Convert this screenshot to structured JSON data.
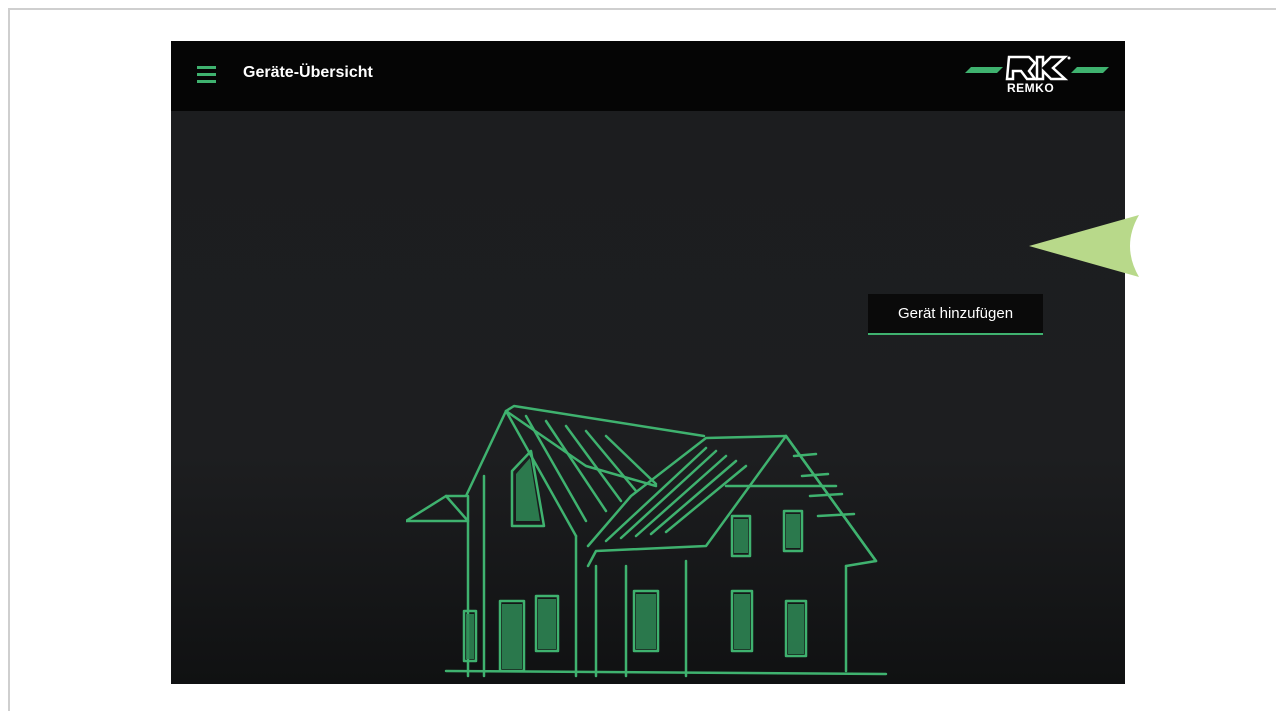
{
  "header": {
    "menu_icon": "hamburger-menu-icon",
    "title": "Geräte-Übersicht",
    "logo_text": "REMKO"
  },
  "main": {
    "add_device_label": "Gerät hinzufügen",
    "illustration": "house-sketch"
  },
  "annotation": {
    "pointer_icon": "arrow-pointer-icon"
  },
  "colors": {
    "accent": "#3fb26f",
    "topbar": "#050505",
    "background": "#1b1c1e",
    "pointer": "#b8d98a"
  }
}
